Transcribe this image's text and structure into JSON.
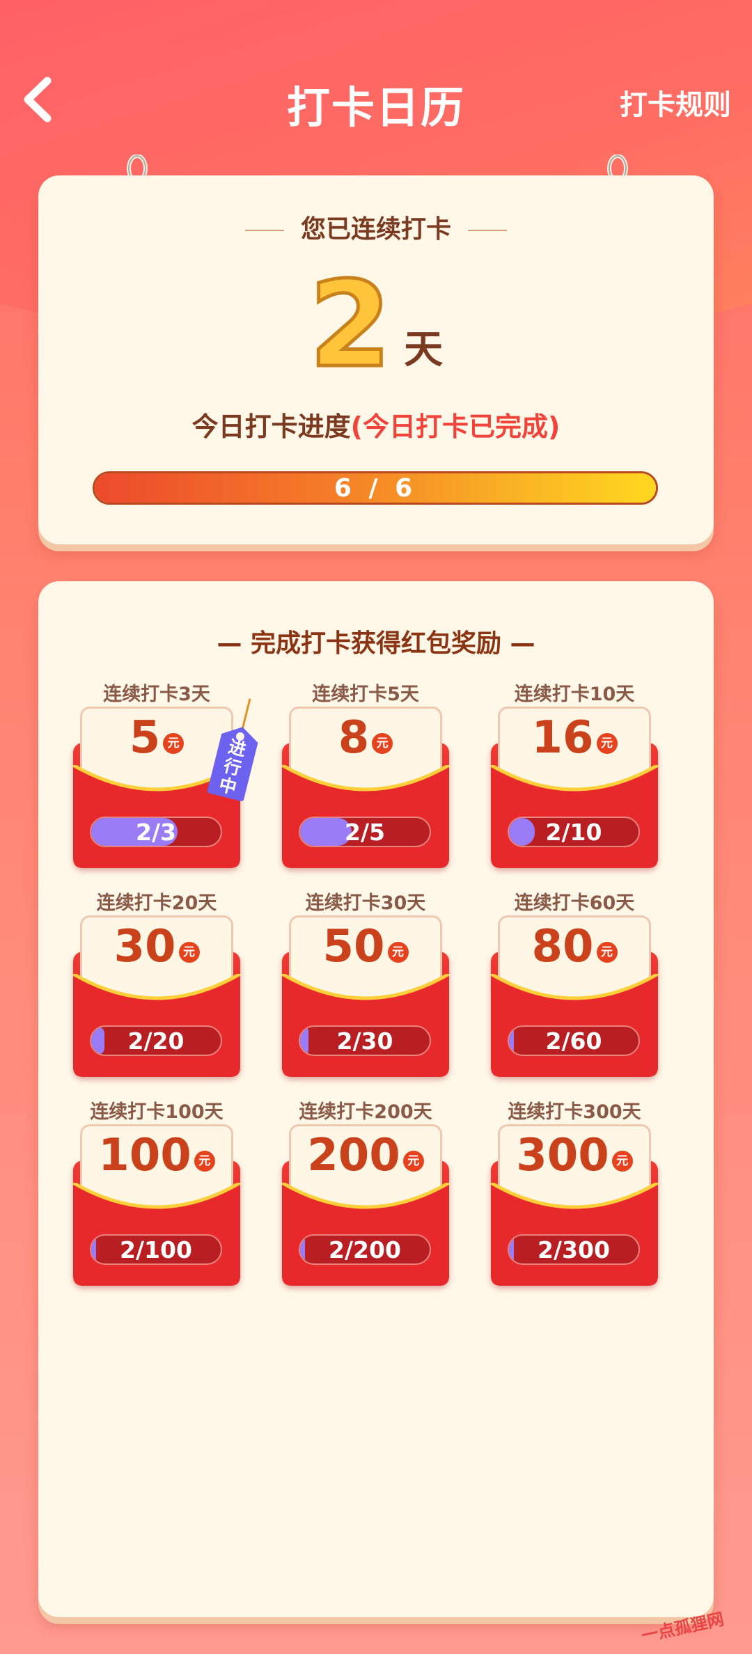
{
  "header": {
    "title": "打卡日历",
    "rules_label": "打卡规则"
  },
  "streak": {
    "heading": "您已连续打卡",
    "days": "2",
    "unit": "天",
    "progress_label": "今日打卡进度",
    "status": "(今日打卡已完成)",
    "progress_text": "6 / 6",
    "progress_fraction": 1.0
  },
  "rewards": {
    "title": "— 完成打卡获得红包奖励 —",
    "currency": "元",
    "in_progress_tag": "进行中",
    "items": [
      {
        "caption": "连续打卡3天",
        "amount": "5",
        "progress": "2/3",
        "fraction": 0.667,
        "active": true
      },
      {
        "caption": "连续打卡5天",
        "amount": "8",
        "progress": "2/5",
        "fraction": 0.4,
        "active": false
      },
      {
        "caption": "连续打卡10天",
        "amount": "16",
        "progress": "2/10",
        "fraction": 0.2,
        "active": false
      },
      {
        "caption": "连续打卡20天",
        "amount": "30",
        "progress": "2/20",
        "fraction": 0.1,
        "active": false
      },
      {
        "caption": "连续打卡30天",
        "amount": "50",
        "progress": "2/30",
        "fraction": 0.067,
        "active": false
      },
      {
        "caption": "连续打卡60天",
        "amount": "80",
        "progress": "2/60",
        "fraction": 0.033,
        "active": false
      },
      {
        "caption": "连续打卡100天",
        "amount": "100",
        "progress": "2/100",
        "fraction": 0.02,
        "active": false
      },
      {
        "caption": "连续打卡200天",
        "amount": "200",
        "progress": "2/200",
        "fraction": 0.01,
        "active": false
      },
      {
        "caption": "连续打卡300天",
        "amount": "300",
        "progress": "2/300",
        "fraction": 0.0067,
        "active": false
      }
    ]
  },
  "watermark": "一点孤狸网",
  "colors": {
    "accent_red": "#e2262a",
    "progress_purple": "#9a7cf6",
    "gold": "#ffc53a"
  }
}
